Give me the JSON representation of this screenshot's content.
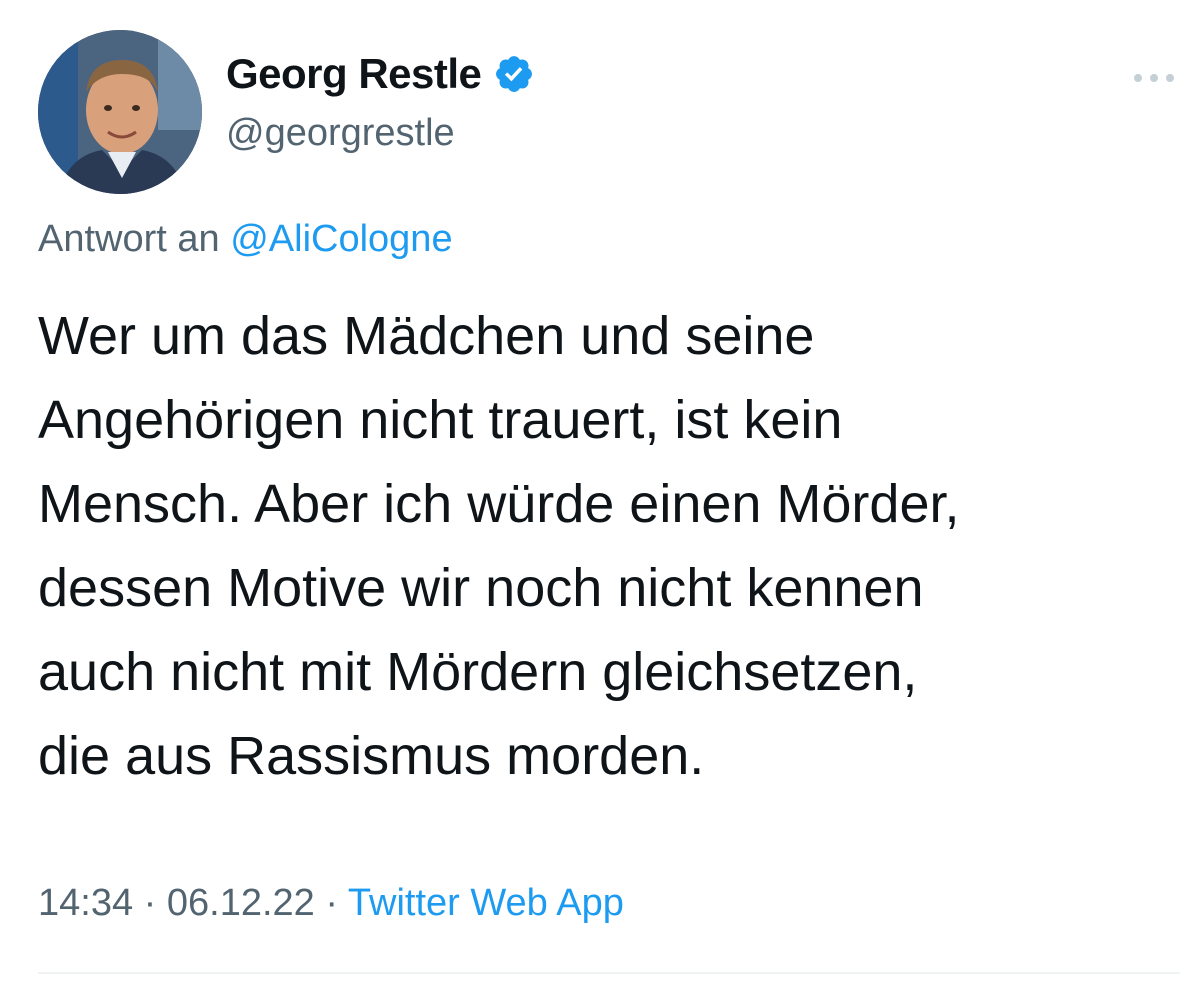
{
  "author": {
    "name": "Georg Restle",
    "handle": "@georgrestle",
    "verified": true,
    "avatar_icon": "avatar-photo"
  },
  "reply": {
    "prefix": "Antwort an",
    "mention": "@AliCologne"
  },
  "tweet": {
    "lines": [
      "Wer um das Mädchen und seine",
      "Angehörigen nicht trauert, ist kein",
      "Mensch. Aber ich würde einen Mörder,",
      "dessen Motive wir noch nicht kennen",
      "auch nicht mit Mördern gleichsetzen,",
      "die aus Rassismus morden."
    ]
  },
  "meta": {
    "time": "14:34",
    "separator": "·",
    "date": "06.12.22",
    "source": "Twitter Web App"
  },
  "icons": {
    "more": "more-options-icon",
    "verified": "verified-badge-icon"
  },
  "colors": {
    "accent": "#1d9bf0",
    "secondary_text": "#536471",
    "primary_text": "#0f1419",
    "divider": "#eff3f4"
  }
}
